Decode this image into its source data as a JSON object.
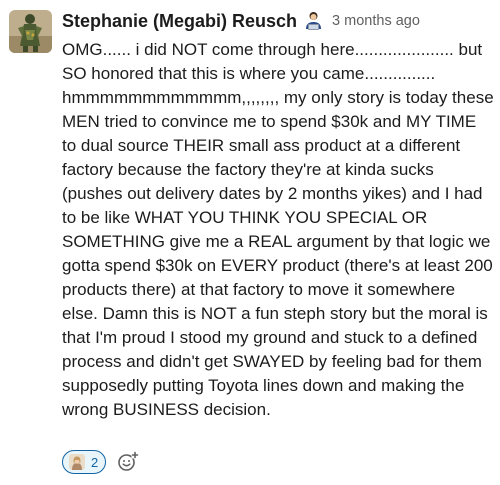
{
  "message": {
    "sender_name": "Stephanie (Megabi) Reusch",
    "timestamp": "3 months ago",
    "status_emoji": "technologist-emoji",
    "body_lines": [
      "OMG...... i did NOT come through here..................... but",
      "SO honored that this is where you came...............",
      "hmmmmmmmmmmmm,,,,,,,, my only story is today these",
      "MEN tried to convince me to spend $30k and MY TIME",
      "to dual source THEIR small ass product at a different",
      "factory because the factory they're at kinda sucks",
      "(pushes out delivery dates by 2 months yikes) and I had",
      "to be like WHAT YOU THINK YOU SPECIAL OR",
      "SOMETHING give me a REAL argument by that logic we",
      "gotta spend $30k on EVERY product (there's at least 200",
      "products there) at that factory to move it somewhere",
      "else. Damn this is NOT a fun steph story but the moral is",
      "that I'm proud I stood my ground and stuck to a defined",
      "process and didn't get SWAYED by feeling bad for them",
      "supposedly putting Toyota lines down and making the",
      "wrong BUSINESS decision."
    ]
  },
  "reactions": [
    {
      "icon": "user-avatar-reaction",
      "count": "2"
    }
  ],
  "add_reaction": {
    "icon": "add-emoji-icon"
  },
  "colors": {
    "text": "#1d1c1d",
    "muted": "#616061",
    "reaction_border": "#1264a3",
    "reaction_bg": "#e8f5fa"
  }
}
